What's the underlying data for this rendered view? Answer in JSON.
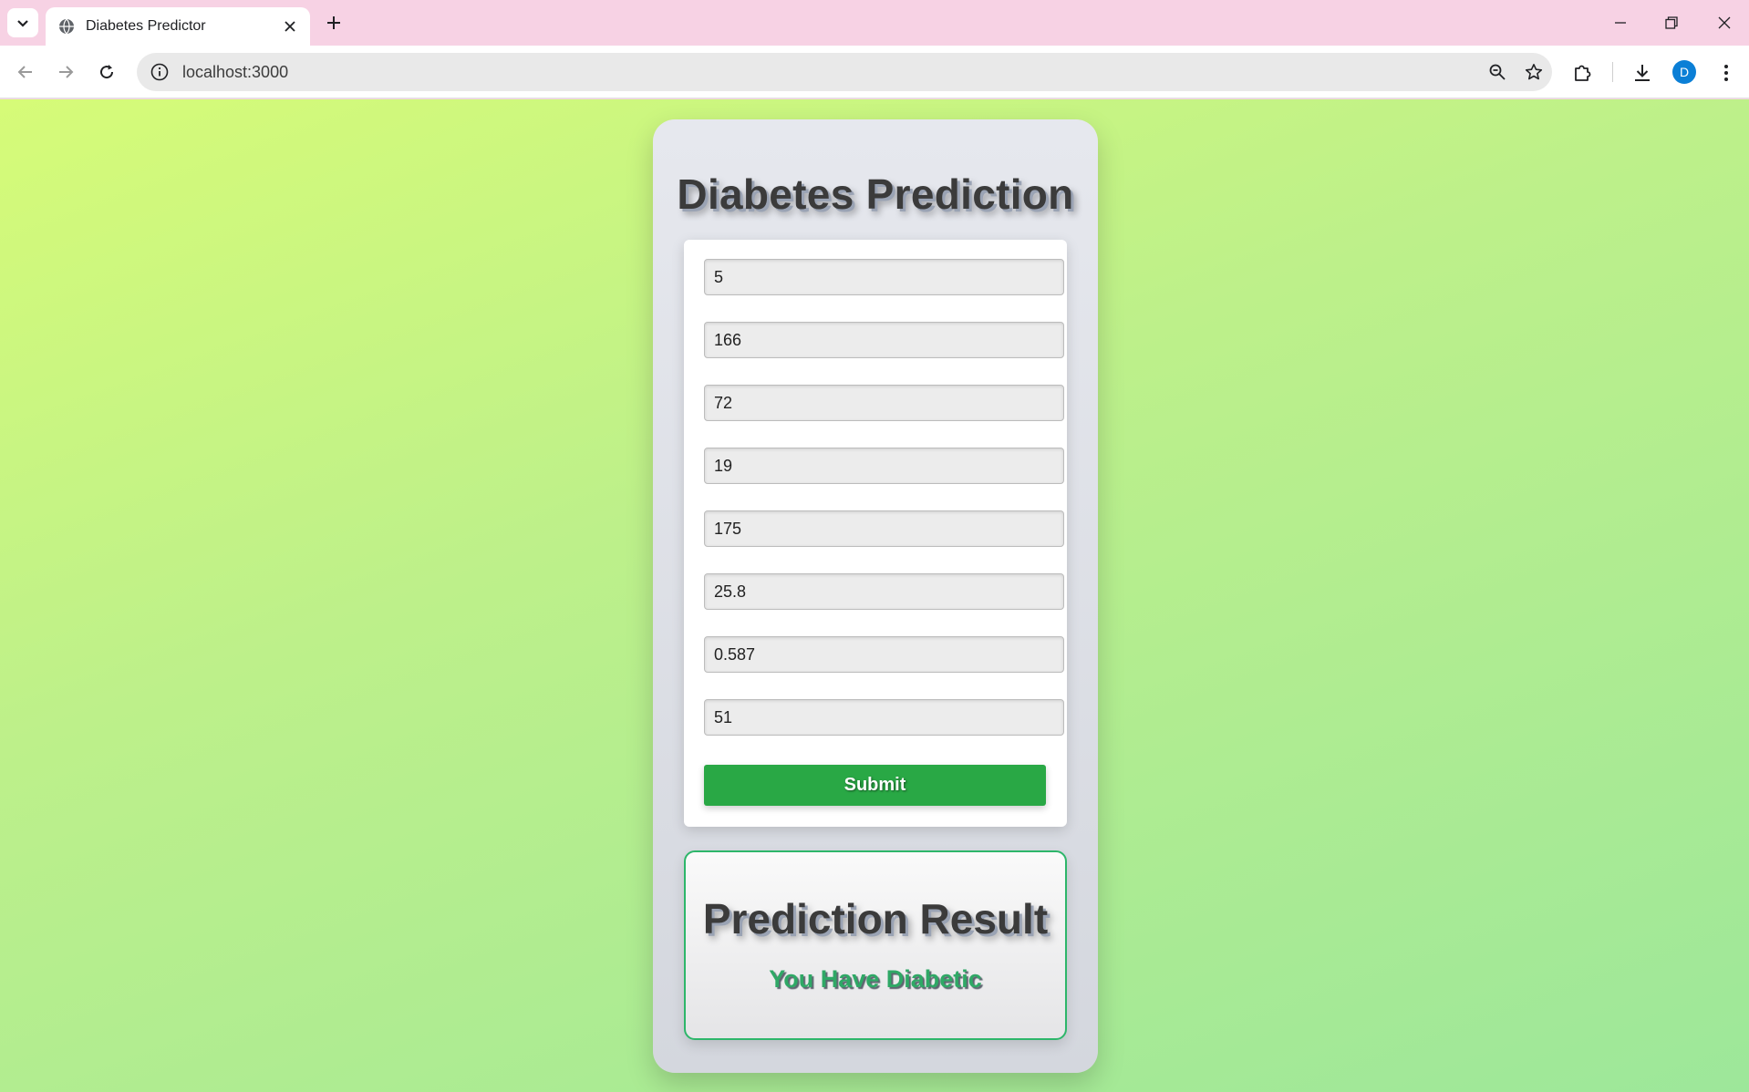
{
  "browser": {
    "tab_title": "Diabetes Predictor",
    "url": "localhost:3000",
    "profile_initial": "D"
  },
  "page": {
    "title": "Diabetes Prediction",
    "fields": [
      "5",
      "166",
      "72",
      "19",
      "175",
      "25.8",
      "0.587",
      "51"
    ],
    "submit_label": "Submit",
    "result_title": "Prediction Result",
    "result_text": "You Have Diabetic"
  },
  "colors": {
    "submit": "#29a845",
    "result_border": "#2db66a",
    "result_text": "#2fa866",
    "background_start": "#d6fb78",
    "background_end": "#9de79a"
  },
  "icons": [
    "chevron-down-icon",
    "globe-icon",
    "close-icon",
    "plus-icon",
    "minimize-icon",
    "restore-icon",
    "window-close-icon",
    "back-icon",
    "forward-icon",
    "reload-icon",
    "info-icon",
    "zoom-icon",
    "star-icon",
    "extensions-icon",
    "download-icon",
    "menu-icon"
  ]
}
